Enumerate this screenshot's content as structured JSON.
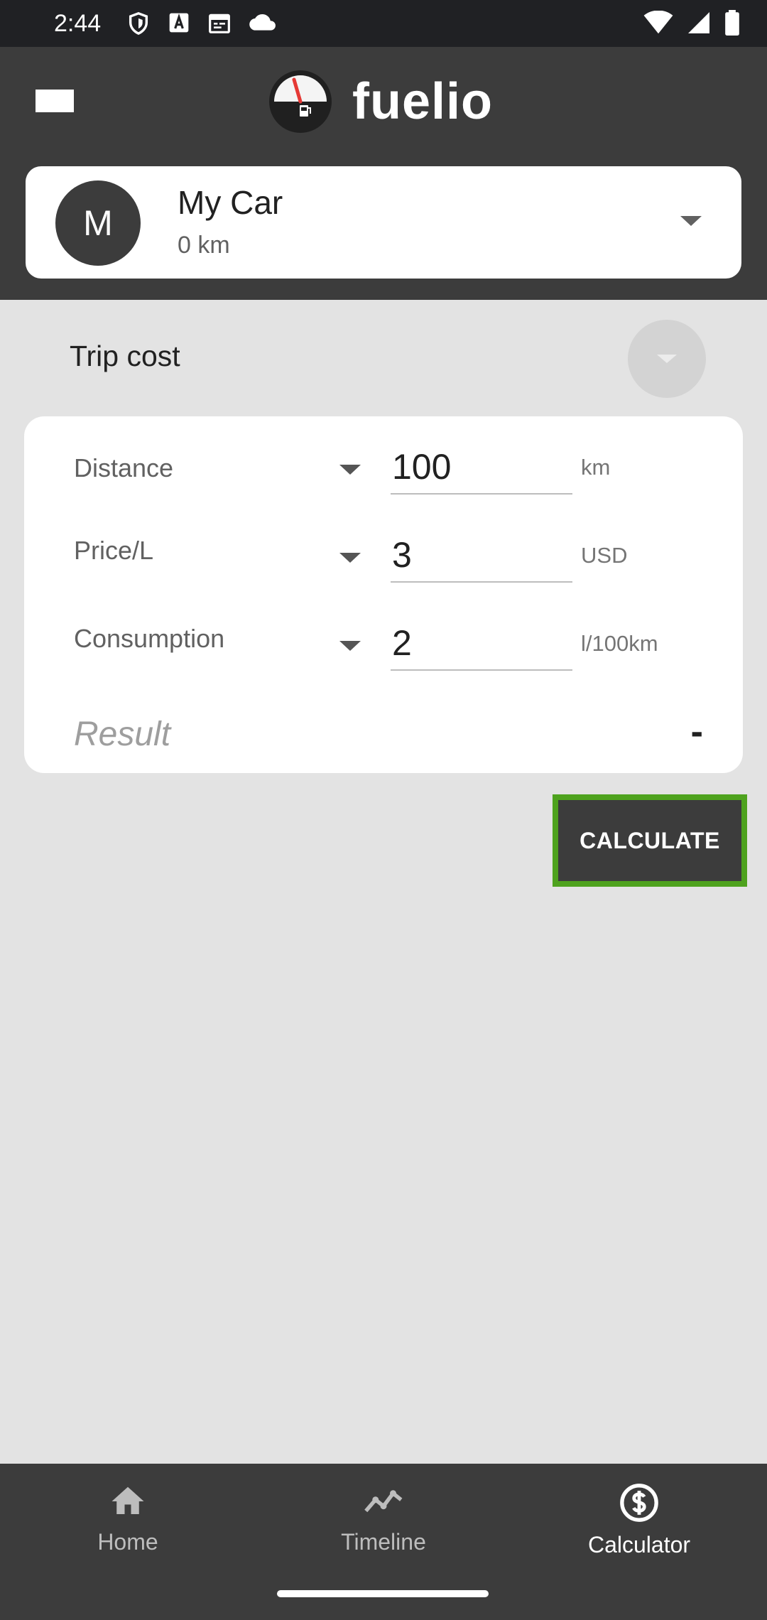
{
  "status": {
    "time": "2:44",
    "icons_left": [
      "shield-icon",
      "a-badge-icon",
      "calendar-icon",
      "cloud-icon"
    ],
    "icons_right": [
      "wifi-icon",
      "signal-icon",
      "battery-icon"
    ]
  },
  "header": {
    "app_name": "fuelio",
    "menu_icon": "menu-icon"
  },
  "car": {
    "avatar_letter": "M",
    "name": "My Car",
    "odometer": "0 km"
  },
  "section": {
    "title": "Trip cost"
  },
  "calculator": {
    "rows": [
      {
        "label": "Distance",
        "value": "100",
        "unit": "km"
      },
      {
        "label": "Price/L",
        "value": "3",
        "unit": "USD"
      },
      {
        "label": "Consumption",
        "value": "2",
        "unit": "l/100km"
      }
    ],
    "result_label": "Result",
    "result_value": "-",
    "button_label": "CALCULATE"
  },
  "nav": {
    "items": [
      {
        "label": "Home",
        "icon": "home-icon"
      },
      {
        "label": "Timeline",
        "icon": "timeline-icon"
      },
      {
        "label": "Calculator",
        "icon": "dollar-circle-icon"
      }
    ]
  },
  "colors": {
    "header_bg": "#3c3c3c",
    "accent_border": "#4ea21e",
    "background": "#e3e3e3",
    "gauge_needle": "#e53935"
  }
}
